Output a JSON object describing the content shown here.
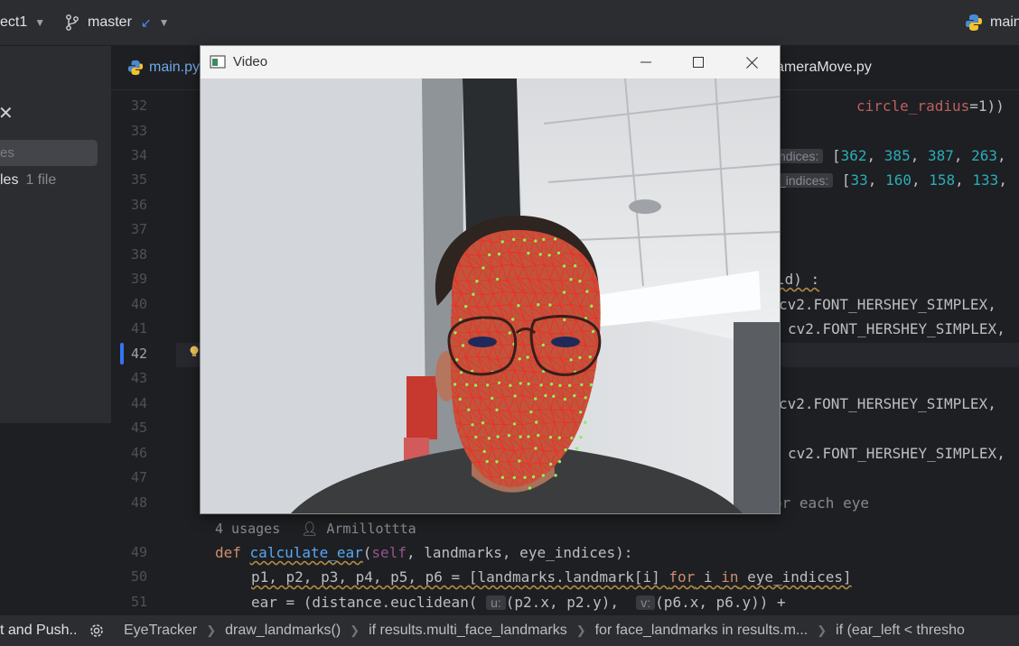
{
  "titlebar": {
    "project": "ect1",
    "branch": "master",
    "run_config": "main"
  },
  "project_panel": {
    "search_placeholder": "es",
    "files_label": "les",
    "files_count": "1 file"
  },
  "tabs": [
    {
      "label": "main.py"
    },
    {
      "label": "ameraMove.py"
    }
  ],
  "editor": {
    "line_numbers": [
      "32",
      "33",
      "34",
      "35",
      "36",
      "37",
      "38",
      "39",
      "40",
      "41",
      "42",
      "43",
      "44",
      "45",
      "46",
      "47",
      "48",
      "49",
      "50",
      "51"
    ],
    "current_line": "42",
    "visible_code": {
      "l32_param": "circle_radius",
      "l32_rest": "=1))",
      "l34_hint": "ndices:",
      "l34_values": [
        "362",
        "385",
        "387",
        "263"
      ],
      "l35_hint": "_indices:",
      "l35_values": [
        "33",
        "160",
        "158",
        "133"
      ],
      "l39": "ld) :",
      "l40": "cv2.FONT_HERSHEY_SIMPLEX,",
      "l41": "cv2.FONT_HERSHEY_SIMPLEX,",
      "l44": "cv2.FONT_HERSHEY_SIMPLEX,",
      "l46": "cv2.FONT_HERSHEY_SIMPLEX,",
      "l48": "or each eye"
    },
    "code_lens": {
      "usages": "4 usages",
      "author": "Armillottta"
    },
    "l49": {
      "kw": "def",
      "name": "calculate_ear",
      "self": "self",
      "rest": ", landmarks, eye_indices):"
    },
    "l50": {
      "head": "p1, p2, p3, p4, p5, p6 = [landmarks.landmark[i] ",
      "kw_for": "for",
      "var": " i ",
      "kw_in": "in",
      "tail": " eye_indices]"
    },
    "l51": {
      "head": "ear = (distance.euclidean( ",
      "hint_u": "u:",
      "mid": "(p2.x, p2.y),  ",
      "hint_v": "v:",
      "tail": "(p6.x, p6.y)) +"
    }
  },
  "statusbar": {
    "commit_push": "t and Push..",
    "breadcrumbs": [
      "EyeTracker",
      "draw_landmarks()",
      "if results.multi_face_landmarks",
      "for face_landmarks in results.m...",
      "if (ear_left < thresho"
    ]
  },
  "video_window": {
    "title": "Video",
    "mesh_color": "#e8332a",
    "point_color": "#8df05a"
  },
  "colors": {
    "editor_bg": "#1e1f22",
    "panel_bg": "#2b2d30",
    "keyword": "#cf8e6d",
    "number": "#2aacb8",
    "function": "#56a8f5",
    "accent": "#3574f0"
  }
}
